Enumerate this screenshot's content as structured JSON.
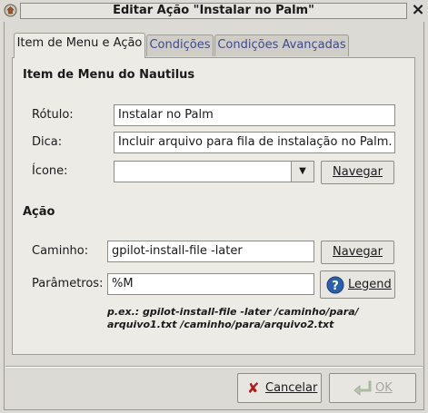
{
  "window": {
    "title": "Editar Ação \"Instalar no Palm\"",
    "close": "×"
  },
  "tabs": [
    "Item de Menu e Ação",
    "Condições",
    "Condições Avançadas"
  ],
  "menu_section": {
    "title": "Item de Menu do Nautilus",
    "label_label": "Rótulo:",
    "label_value": "Instalar no Palm",
    "tooltip_label": "Dica:",
    "tooltip_value": "Incluir arquivo para fila de instalação no Palm.",
    "icon_label": "Ícone:",
    "icon_value": "",
    "browse": "Navegar"
  },
  "action_section": {
    "title": "Ação",
    "path_label": "Caminho:",
    "path_value": "gpilot-install-file -later",
    "browse": "Navegar",
    "params_label": "Parâmetros:",
    "params_value": "%M",
    "legend": "Legend",
    "example_line1": "p.ex.: gpilot-install-file -later /caminho/para/",
    "example_line2": "arquivo1.txt /caminho/para/arquivo2.txt"
  },
  "buttons": {
    "cancel": "Cancelar",
    "ok": "OK"
  },
  "colors": {
    "background": "#dcdad5",
    "tab_text": "#3c4a8c",
    "help_blue": "#2d5fa8"
  }
}
